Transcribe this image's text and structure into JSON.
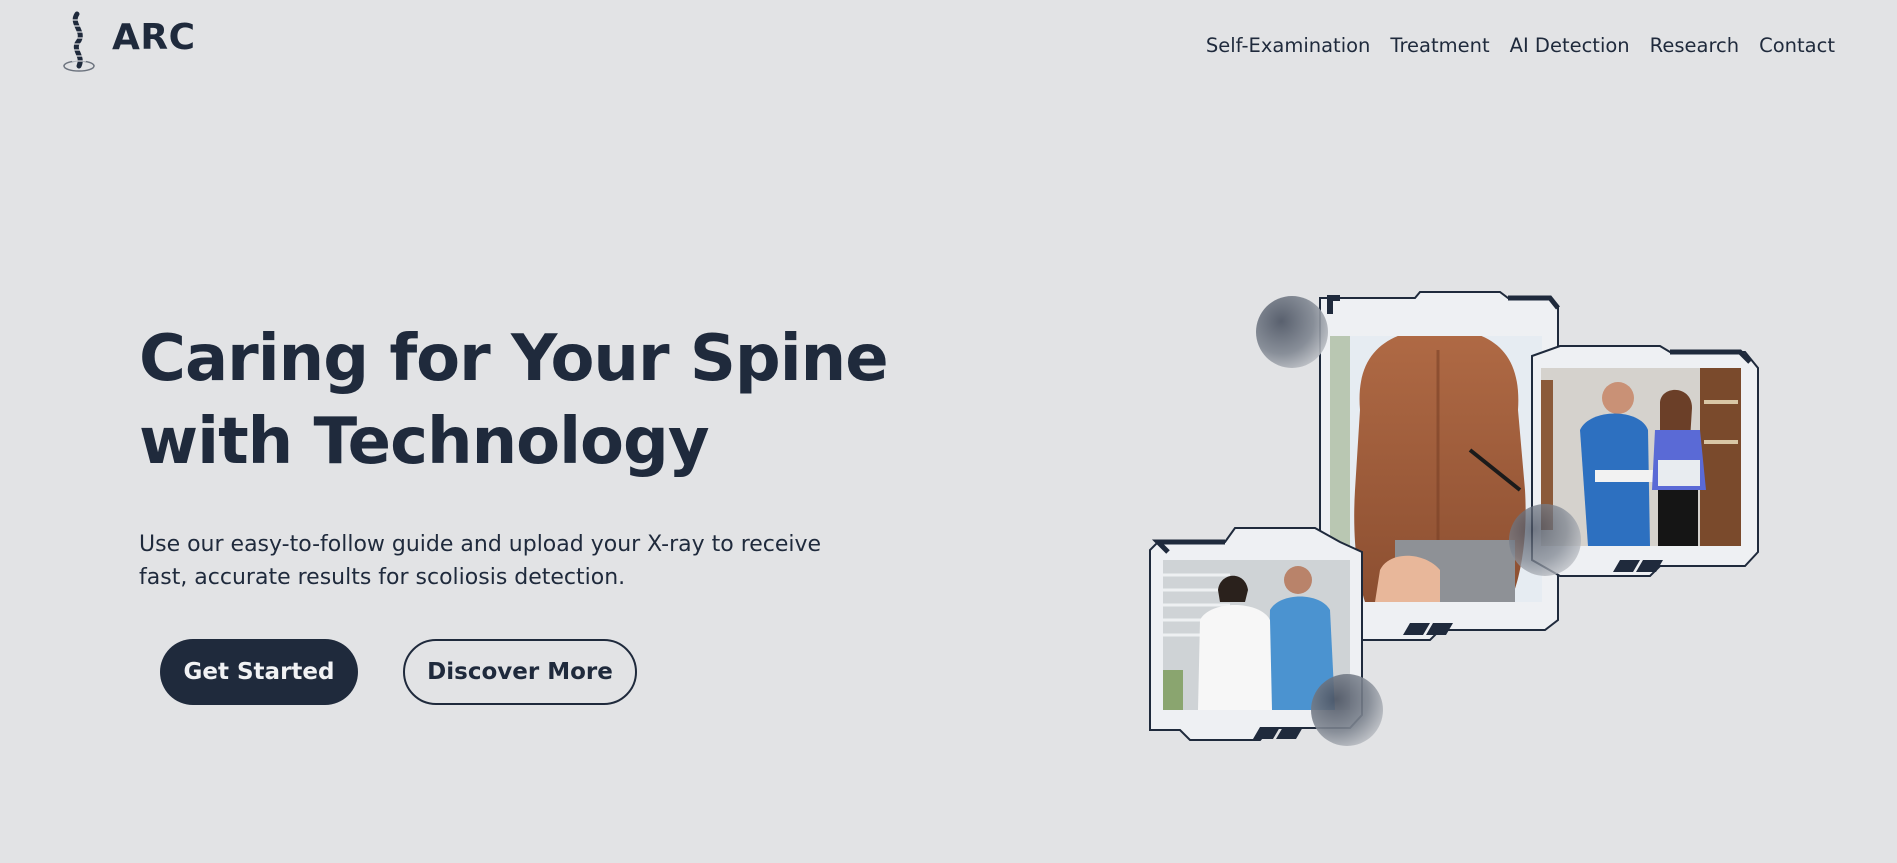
{
  "brand": {
    "name": "ARC",
    "logo_icon": "spine-icon"
  },
  "nav": {
    "items": [
      {
        "label": "Self-Examination"
      },
      {
        "label": "Treatment"
      },
      {
        "label": "AI Detection"
      },
      {
        "label": "Research"
      },
      {
        "label": "Contact"
      }
    ]
  },
  "hero": {
    "title_line1": "Caring for Your Spine",
    "title_line2": "with Technology",
    "subtitle_line1": "Use our easy-to-follow guide and upload your X-ray to receive",
    "subtitle_line2": "fast, accurate results for scoliosis detection.",
    "primary_button": "Get Started",
    "secondary_button": "Discover More"
  },
  "collage": {
    "photos": [
      {
        "icon": "spine-exam-photo"
      },
      {
        "icon": "back-brace-fitting-photo"
      },
      {
        "icon": "shoulder-assessment-photo"
      }
    ]
  },
  "colors": {
    "background": "#e2e3e5",
    "primary": "#1f2a3c",
    "on_primary": "#f1f2f4"
  }
}
